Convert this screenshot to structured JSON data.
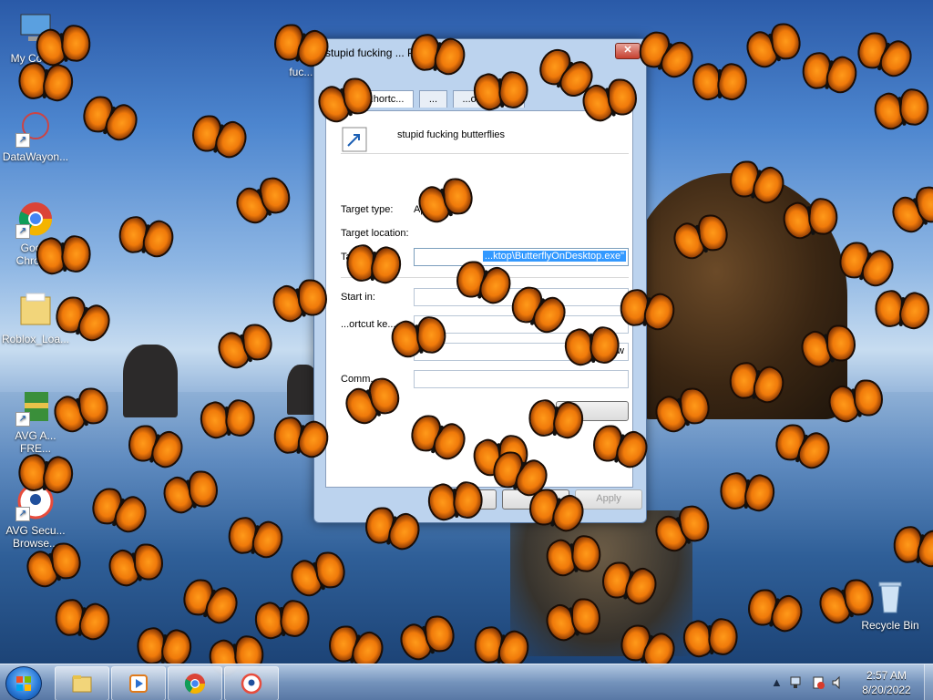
{
  "desktop": {
    "icons": [
      {
        "label": "My Com...",
        "icon": "computer-icon"
      },
      {
        "label": "DataWayon...",
        "icon": "app-icon"
      },
      {
        "label": "Goo... Chrome",
        "icon": "chrome-icon"
      },
      {
        "label": "Roblox_Loa...",
        "icon": "folder-icon"
      },
      {
        "label": "AVG A... FRE...",
        "icon": "avg-antivirus-icon"
      },
      {
        "label": "AVG Secu... Browse...",
        "icon": "avg-browser-icon"
      },
      {
        "label": "Recycle Bin",
        "icon": "recycle-bin-icon"
      }
    ],
    "partial_label": "fuc... butt..."
  },
  "dialog": {
    "title": "stupid fucking ... Properti...",
    "tabs": [
      "...",
      "...hortc...",
      "...",
      "...ompatib..."
    ],
    "shortcut_name": "stupid fucking butterflies",
    "target_type_label": "Target type:",
    "target_type_value": "Applica...",
    "target_location_label": "Target location:",
    "target_label": "Target:",
    "target_value": "...ktop\\ButterflyOnDesktop.exe\"",
    "start_in_label": "Start in:",
    "shortcut_key_label": "...ortcut ke...",
    "run_value": "...ndow",
    "comment_label": "Comm...",
    "apply_label": "Apply",
    "close_label": "✕"
  },
  "taskbar": {
    "apps": [
      {
        "name": "explorer",
        "icon": "folder-icon"
      },
      {
        "name": "media-player",
        "icon": "media-player-icon"
      },
      {
        "name": "chrome",
        "icon": "chrome-icon"
      },
      {
        "name": "avg-browser",
        "icon": "avg-browser-icon"
      }
    ],
    "tray_text": "▲",
    "time": "2:57 AM",
    "date": "8/20/2022"
  },
  "colors": {
    "butterfly": "#f07a0a",
    "selection": "#3399ff",
    "taskbar": "#7896be"
  }
}
